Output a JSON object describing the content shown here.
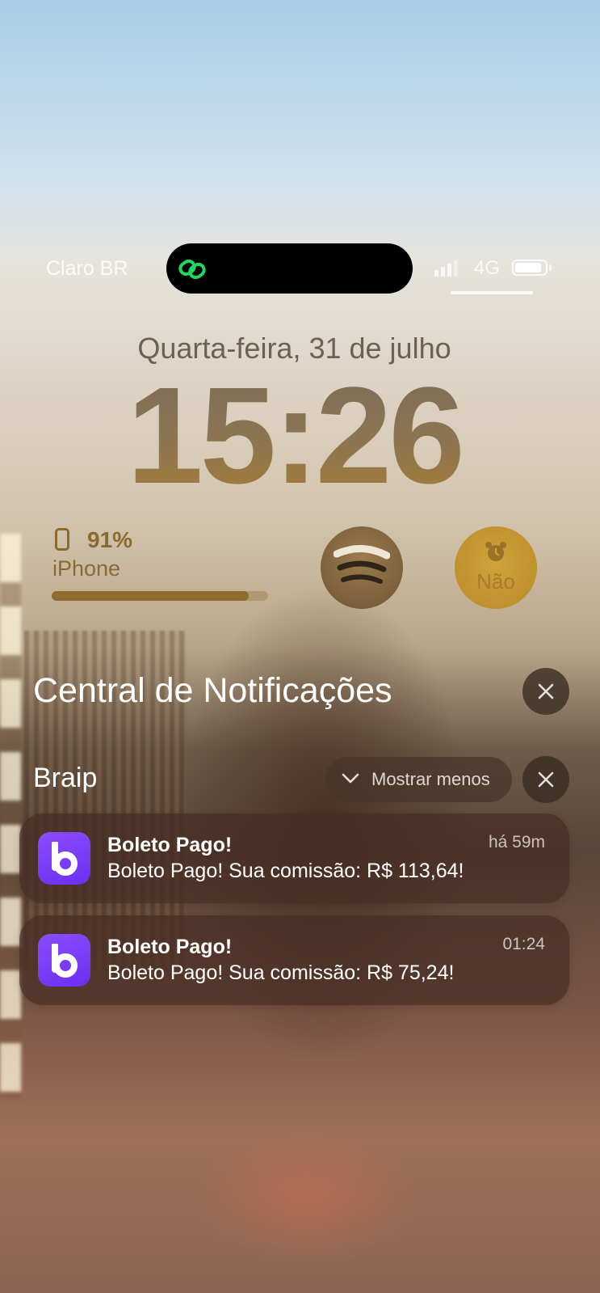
{
  "status_bar": {
    "carrier": "Claro BR",
    "network": "4G",
    "island_icon": "linked-rings-icon",
    "battery_level": 0.9
  },
  "lock_screen": {
    "date": "Quarta-feira, 31 de julho",
    "time": "15:26"
  },
  "widgets": {
    "battery": {
      "percent": "91%",
      "device": "iPhone",
      "level": 0.91,
      "icon": "phone-icon"
    },
    "spotify": {
      "icon": "spotify-icon"
    },
    "alarm": {
      "icon": "alarm-clock-icon",
      "label": "Não"
    }
  },
  "notification_center": {
    "title": "Central de Notificações",
    "group": {
      "name": "Braip",
      "show_less_label": "Mostrar menos"
    },
    "notifications": [
      {
        "app_icon": "braip-b-icon",
        "title": "Boleto Pago!",
        "body": "Boleto Pago! Sua comissão: R$ 113,64!",
        "time": "há 59m"
      },
      {
        "app_icon": "braip-b-icon",
        "title": "Boleto Pago!",
        "body": "Boleto Pago! Sua comissão: R$ 75,24!",
        "time": "01:24"
      }
    ]
  },
  "colors": {
    "spotify_green": "#1ed760",
    "app_purple": "#7a3cff",
    "widget_gold": "#8a6a2f"
  }
}
